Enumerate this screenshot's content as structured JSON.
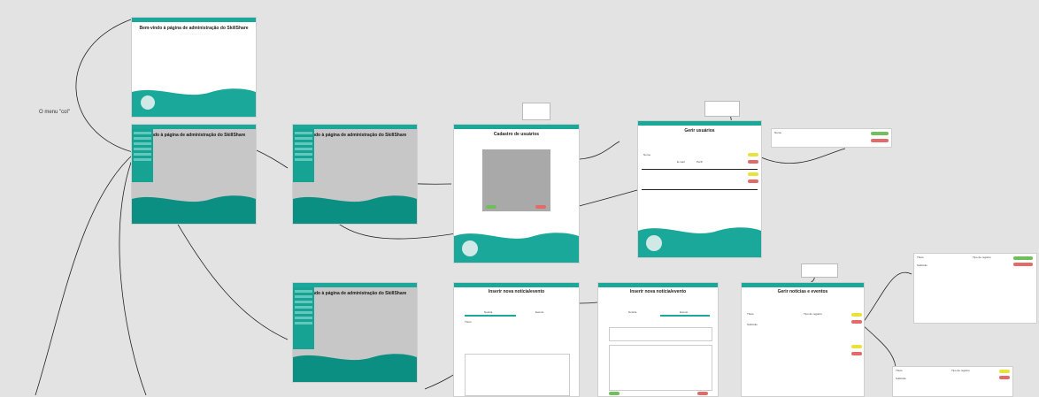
{
  "annotation": "O menu \"col\"",
  "screens": {
    "home_title": "Bem-vindo à página de administração do SkillShare",
    "home_title_partial": "m-vindo à página de administração do SkillShare",
    "users_title": "Cadastro de usuários",
    "manage_users_title": "Gerir usuários",
    "news_title": "Inserir nova notícia/evento",
    "manage_news_title": "Gerir notícias e eventos",
    "news_tab_left": "Notícia",
    "news_tab_right": "Evento",
    "field_titulo": "Título",
    "field_subtitulo": "Subtítulo",
    "field_tipo": "Tipo de registro",
    "field_nome": "Nome",
    "field_email": "E-mail",
    "field_perfil": "Perfil"
  },
  "colors": {
    "teal": "#1aa89a",
    "dark_teal": "#0b8f83",
    "yellow": "#e8e23a",
    "red": "#e46a6a",
    "green": "#6fbf5a"
  }
}
